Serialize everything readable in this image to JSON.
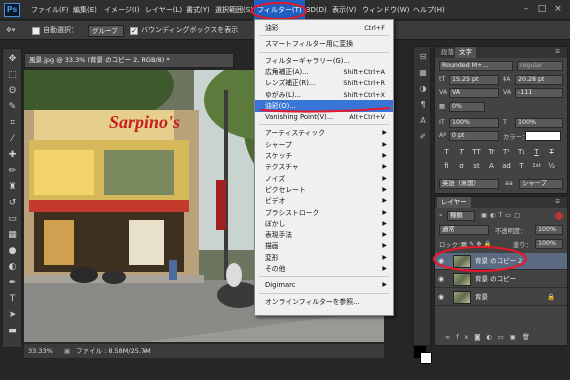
{
  "app": {
    "logo": "Ps"
  },
  "menubar": {
    "items": [
      "ファイル(F)",
      "編集(E)",
      "イメージ(I)",
      "レイヤー(L)",
      "書式(Y)",
      "選択範囲(S)",
      "フィルター(T)",
      "3D(D)",
      "表示(V)",
      "ウィンドウ(W)",
      "ヘルプ(H)"
    ],
    "active": "フィルター(T)",
    "window_controls": [
      "–",
      "□",
      "×"
    ]
  },
  "options": {
    "auto_select_label": "自動選択：",
    "auto_select_value": "グループ",
    "bounding_box_label": "バウンディングボックスを表示"
  },
  "document": {
    "tab_title": "風景.jpg @ 33.3% (背景 のコピー 2, RGB/8) *",
    "zoom": "33.33%",
    "file_info": "ファイル : 8.58M/25.7M",
    "storefront_sign": "Sarpino's"
  },
  "filter_menu": {
    "items": [
      {
        "label": "油彩",
        "shortcut": "Ctrl+F"
      },
      {
        "separator": true
      },
      {
        "label": "スマートフィルター用に変換"
      },
      {
        "separator": true
      },
      {
        "label": "フィルターギャラリー(G)..."
      },
      {
        "label": "広角補正(A)...",
        "shortcut": "Shift+Ctrl+A"
      },
      {
        "label": "レンズ補正(R)...",
        "shortcut": "Shift+Ctrl+R"
      },
      {
        "label": "ゆがみ(L)...",
        "shortcut": "Shift+Ctrl+X"
      },
      {
        "label": "油彩(O)...",
        "highlighted": true
      },
      {
        "label": "Vanishing Point(V)...",
        "shortcut": "Alt+Ctrl+V"
      },
      {
        "separator": true
      },
      {
        "label": "アーティスティック",
        "submenu": true
      },
      {
        "label": "シャープ",
        "submenu": true
      },
      {
        "label": "スケッチ",
        "submenu": true
      },
      {
        "label": "テクスチャ",
        "submenu": true
      },
      {
        "label": "ノイズ",
        "submenu": true
      },
      {
        "label": "ピクセレート",
        "submenu": true
      },
      {
        "label": "ビデオ",
        "submenu": true
      },
      {
        "label": "ブラシストローク",
        "submenu": true
      },
      {
        "label": "ぼかし",
        "submenu": true
      },
      {
        "label": "表現手法",
        "submenu": true
      },
      {
        "label": "描画",
        "submenu": true
      },
      {
        "label": "変形",
        "submenu": true
      },
      {
        "label": "その他",
        "submenu": true
      },
      {
        "separator": true
      },
      {
        "label": "Digimarc",
        "submenu": true
      },
      {
        "separator": true
      },
      {
        "label": "オンラインフィルターを参照..."
      }
    ]
  },
  "character_panel": {
    "tabs": [
      "段落",
      "文字"
    ],
    "font_family": "Rounded M+...",
    "font_style": "regular",
    "font_size": "15.25 pt",
    "leading": "20.28 pt",
    "kerning": "VA",
    "tracking": "-111",
    "tsume": "0%",
    "vscale": "100%",
    "hscale": "100%",
    "baseline": "0 pt",
    "color_label": "カラー：",
    "style_buttons": [
      "T",
      "T",
      "TT",
      "Tr",
      "T¹",
      "T₁",
      "T",
      "T"
    ],
    "ligature_buttons": [
      "fi",
      "σ",
      "st",
      "A",
      "ad",
      "T",
      "1st",
      "½"
    ],
    "language": "英語（米国）",
    "antialias": "シャープ",
    "aa_label": "aa"
  },
  "layers_panel": {
    "tab": "レイヤー",
    "filter_label": "種類",
    "blend_mode": "通常",
    "opacity_label": "不透明度：",
    "opacity": "100%",
    "lock_label": "ロック：",
    "fill_label": "塗り：",
    "fill": "100%",
    "layers": [
      {
        "name": "背景 のコピー 2",
        "selected": true
      },
      {
        "name": "背景 のコピー"
      },
      {
        "name": "背景",
        "locked": true
      }
    ]
  },
  "colors": {
    "accent": "#3875d7",
    "annotation": "#e8182b"
  }
}
